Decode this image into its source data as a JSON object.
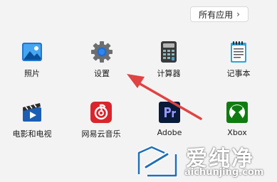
{
  "header": {
    "all_apps_label": "所有应用",
    "chevron": "›"
  },
  "apps": [
    {
      "label": "照片",
      "icon": "photos-icon"
    },
    {
      "label": "设置",
      "icon": "settings-gear-icon"
    },
    {
      "label": "计算器",
      "icon": "calculator-icon"
    },
    {
      "label": "记事本",
      "icon": "notepad-icon"
    },
    {
      "label": "电影和电视",
      "icon": "movies-tv-icon"
    },
    {
      "label": "网易云音乐",
      "icon": "netease-music-icon"
    },
    {
      "label": "Adobe",
      "icon": "adobe-premiere-icon"
    },
    {
      "label": "Xbox",
      "icon": "xbox-icon"
    }
  ],
  "watermark": {
    "cn": "爱纯净",
    "en": "aichunjing.com"
  },
  "colors": {
    "background": "#f3f3f3",
    "arrow": "#e04343",
    "netease": "#d9252b",
    "xbox": "#107c10",
    "adobe_bg": "#0a1a3a",
    "adobe_accent": "#9999ff"
  }
}
